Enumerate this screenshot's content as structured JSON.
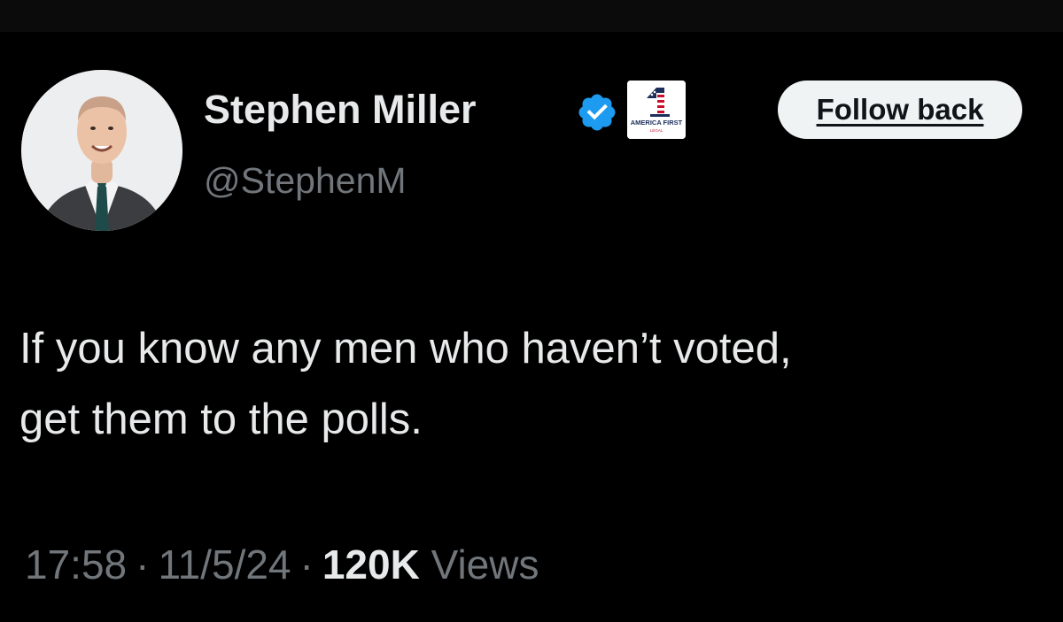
{
  "author": {
    "display_name": "Stephen Miller",
    "handle": "@StephenM",
    "verified": true,
    "verified_color": "#1d9bf0",
    "affiliate_badge_text": "AMERICA FIRST",
    "affiliate_badge_subtext": "LEGAL"
  },
  "actions": {
    "follow_label": "Follow back"
  },
  "tweet": {
    "lines": [
      "If you know any men who haven’t voted,",
      "get them to the polls."
    ]
  },
  "meta": {
    "time": "17:58",
    "separator": "·",
    "date": "11/5/24",
    "views_count": "120K",
    "views_label": "Views"
  },
  "colors": {
    "background": "#000000",
    "primary_text": "#e7e9ea",
    "secondary_text": "#71767b",
    "button_bg": "#eff3f4"
  }
}
